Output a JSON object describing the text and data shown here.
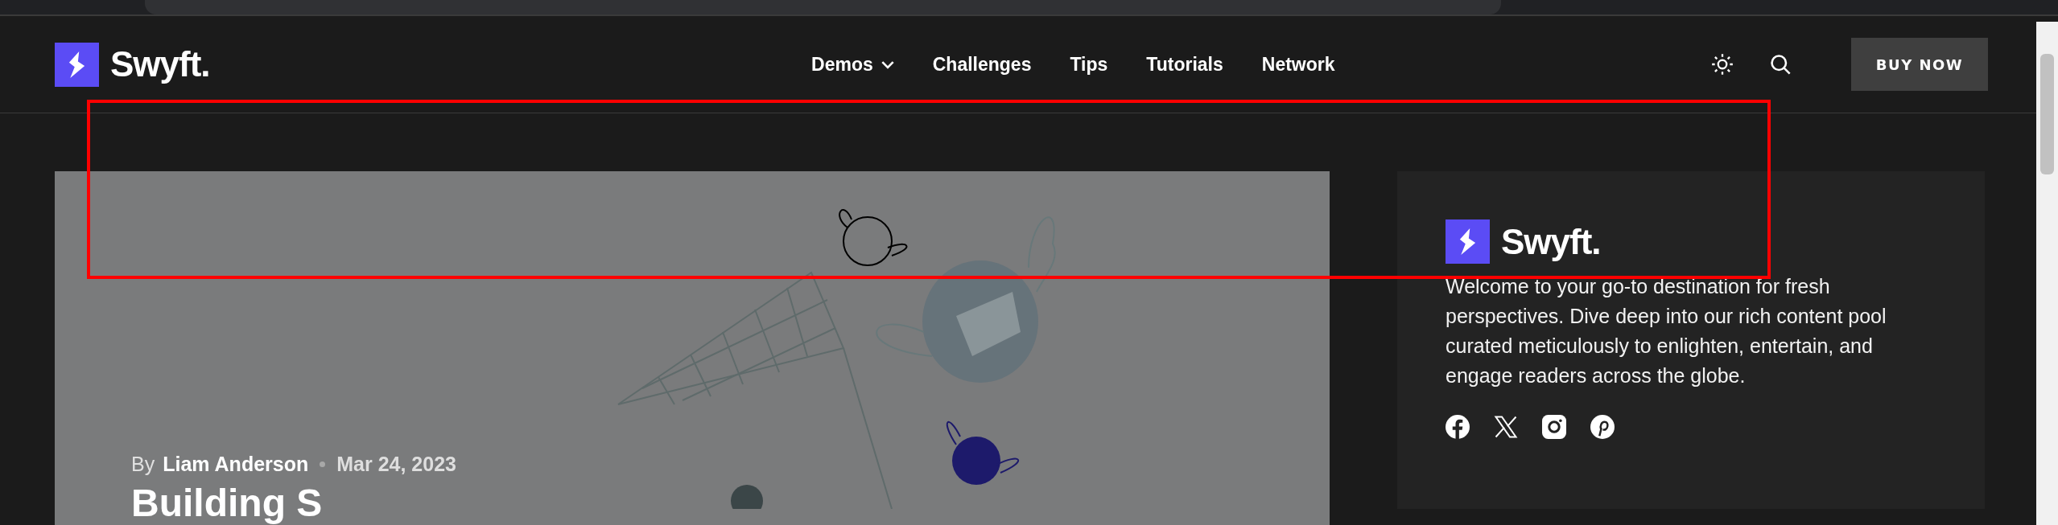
{
  "header": {
    "logo": "Swyft.",
    "nav": [
      {
        "label": "Demos",
        "has_menu": true
      },
      {
        "label": "Challenges",
        "has_menu": false
      },
      {
        "label": "Tips",
        "has_menu": false
      },
      {
        "label": "Tutorials",
        "has_menu": false
      },
      {
        "label": "Network",
        "has_menu": false
      }
    ],
    "button": "BUY NOW"
  },
  "hero": {
    "by": "By",
    "author": "Liam Anderson",
    "date": "Mar 24, 2023",
    "title": "Building S"
  },
  "sidebar": {
    "logo": "Swyft.",
    "text": "Welcome to your go-to destination for fresh perspectives. Dive deep into our rich content pool curated meticulously to enlighten, entertain, and engage readers across the globe.",
    "social": [
      {
        "kind": "facebook"
      },
      {
        "kind": "x"
      },
      {
        "kind": "instagram"
      },
      {
        "kind": "pinterest"
      }
    ]
  }
}
